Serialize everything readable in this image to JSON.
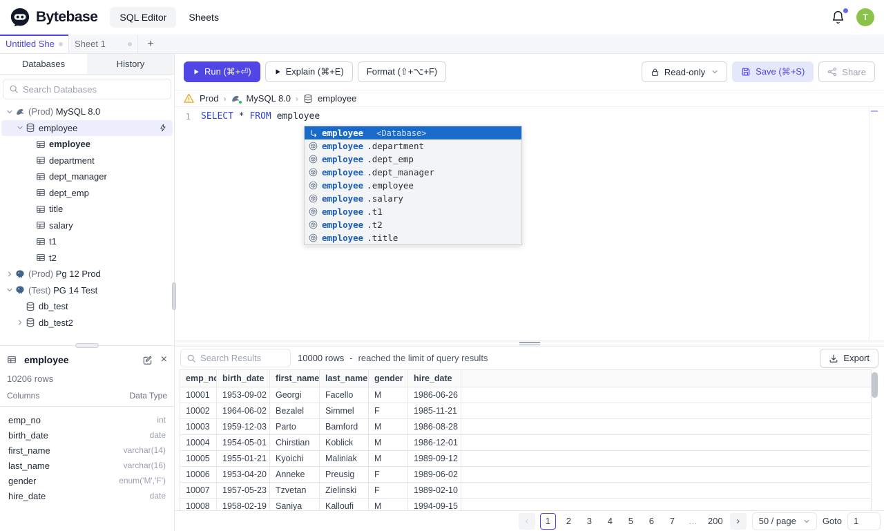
{
  "colors": {
    "accent": "#4f46e5",
    "accent_soft": "#e5e7fb",
    "keyword": "#2f43cd",
    "suggest_selected": "#1a6ac9",
    "suggest_name": "#1a5db8",
    "selected_row": "#edeffd",
    "avatar": "#8bc34a",
    "warning": "#f59e0b",
    "dot": "#6366f1",
    "status_ok": "#22c55e"
  },
  "header": {
    "logo_text": "Bytebase",
    "nav": [
      {
        "label": "SQL Editor",
        "active": true
      },
      {
        "label": "Sheets",
        "active": false
      }
    ],
    "avatar": "T"
  },
  "sheet_tabs": {
    "tabs": [
      {
        "label": "Untitled Sheet",
        "active": true
      },
      {
        "label": "Sheet 1",
        "active": false
      }
    ],
    "add": "+"
  },
  "sidebar": {
    "tabs": [
      {
        "label": "Databases",
        "active": true
      },
      {
        "label": "History",
        "active": false
      }
    ],
    "search_placeholder": "Search Databases",
    "tree": [
      {
        "level": 0,
        "chevron": "down",
        "icon": "mysql",
        "prefix": "(Prod) ",
        "name": "MySQL 8.0"
      },
      {
        "level": 1,
        "chevron": "down",
        "icon": "database",
        "name": "employee",
        "selected": true,
        "action": "bolt"
      },
      {
        "level": 2,
        "chevron": "none",
        "icon": "table",
        "name": "employee",
        "bold": true
      },
      {
        "level": 2,
        "chevron": "none",
        "icon": "table",
        "name": "department"
      },
      {
        "level": 2,
        "chevron": "none",
        "icon": "table",
        "name": "dept_manager"
      },
      {
        "level": 2,
        "chevron": "none",
        "icon": "table",
        "name": "dept_emp"
      },
      {
        "level": 2,
        "chevron": "none",
        "icon": "table",
        "name": "title"
      },
      {
        "level": 2,
        "chevron": "none",
        "icon": "table",
        "name": "salary"
      },
      {
        "level": 2,
        "chevron": "none",
        "icon": "table",
        "name": "t1"
      },
      {
        "level": 2,
        "chevron": "none",
        "icon": "table",
        "name": "t2"
      },
      {
        "level": 0,
        "chevron": "right",
        "icon": "pg",
        "prefix": "(Prod) ",
        "name": "Pg 12 Prod"
      },
      {
        "level": 0,
        "chevron": "down",
        "icon": "pg",
        "prefix": "(Test) ",
        "name": "PG 14 Test"
      },
      {
        "level": 1,
        "chevron": "none",
        "icon": "database",
        "name": "db_test"
      },
      {
        "level": 1,
        "chevron": "right",
        "icon": "database",
        "name": "db_test2"
      }
    ]
  },
  "table_panel": {
    "title": "employee",
    "row_count": "10206 rows",
    "columns_label": "Columns",
    "datatype_label": "Data Type",
    "fields": [
      {
        "name": "emp_no",
        "type": "int"
      },
      {
        "name": "birth_date",
        "type": "date"
      },
      {
        "name": "first_name",
        "type": "varchar(14)"
      },
      {
        "name": "last_name",
        "type": "varchar(16)"
      },
      {
        "name": "gender",
        "type": "enum('M','F')"
      },
      {
        "name": "hire_date",
        "type": "date"
      }
    ]
  },
  "toolbar": {
    "run_label": "Run (⌘+⏎)",
    "explain_label": "Explain (⌘+E)",
    "format_label": "Format (⇧+⌥+F)",
    "readonly_label": "Read-only",
    "save_label": "Save (⌘+S)",
    "share_label": "Share"
  },
  "breadcrumb": {
    "items": [
      "Prod",
      "MySQL 8.0",
      "employee"
    ]
  },
  "editor": {
    "line_number": "1",
    "tokens": [
      {
        "text": "SELECT",
        "type": "keyword"
      },
      {
        "text": " ",
        "type": "plain"
      },
      {
        "text": "*",
        "type": "operator"
      },
      {
        "text": " ",
        "type": "plain"
      },
      {
        "text": "FROM",
        "type": "keyword"
      },
      {
        "text": " ",
        "type": "plain"
      },
      {
        "text": "employee",
        "type": "plain"
      }
    ]
  },
  "autocomplete": {
    "items": [
      {
        "name": "employee",
        "detail": "<Database>",
        "selected": true
      },
      {
        "name": "employee",
        "suffix": ".department"
      },
      {
        "name": "employee",
        "suffix": ".dept_emp"
      },
      {
        "name": "employee",
        "suffix": ".dept_manager"
      },
      {
        "name": "employee",
        "suffix": ".employee"
      },
      {
        "name": "employee",
        "suffix": ".salary"
      },
      {
        "name": "employee",
        "suffix": ".t1"
      },
      {
        "name": "employee",
        "suffix": ".t2"
      },
      {
        "name": "employee",
        "suffix": ".title"
      }
    ]
  },
  "results": {
    "search_placeholder": "Search Results",
    "rows_count": "10000 rows",
    "dash": "-",
    "limit_note": "reached the limit of query results",
    "export_label": "Export",
    "columns": [
      "emp_no",
      "birth_date",
      "first_name",
      "last_name",
      "gender",
      "hire_date"
    ],
    "rows": [
      [
        "10001",
        "1953-09-02",
        "Georgi",
        "Facello",
        "M",
        "1986-06-26"
      ],
      [
        "10002",
        "1964-06-02",
        "Bezalel",
        "Simmel",
        "F",
        "1985-11-21"
      ],
      [
        "10003",
        "1959-12-03",
        "Parto",
        "Bamford",
        "M",
        "1986-08-28"
      ],
      [
        "10004",
        "1954-05-01",
        "Chirstian",
        "Koblick",
        "M",
        "1986-12-01"
      ],
      [
        "10005",
        "1955-01-21",
        "Kyoichi",
        "Maliniak",
        "M",
        "1989-09-12"
      ],
      [
        "10006",
        "1953-04-20",
        "Anneke",
        "Preusig",
        "F",
        "1989-06-02"
      ],
      [
        "10007",
        "1957-05-23",
        "Tzvetan",
        "Zielinski",
        "F",
        "1989-02-10"
      ],
      [
        "10008",
        "1958-02-19",
        "Saniya",
        "Kalloufi",
        "M",
        "1994-09-15"
      ]
    ]
  },
  "pagination": {
    "prev": "‹",
    "next": "›",
    "pages": [
      "1",
      "2",
      "3",
      "4",
      "5",
      "6",
      "7",
      "…",
      "200"
    ],
    "active_page": "1",
    "page_size": "50 / page",
    "goto_label": "Goto",
    "goto_value": "1"
  }
}
